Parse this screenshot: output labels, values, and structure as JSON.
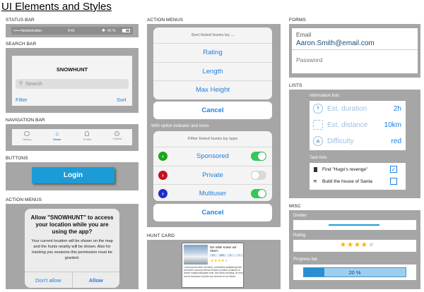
{
  "page": {
    "title": "UI Elements and Styles"
  },
  "labels": {
    "status_bar": "STATUS BAR",
    "search_bar": "SEARCH BAR",
    "navigation_bar": "NAVIGATION BAR",
    "buttons": "BUTTONS",
    "action_menus_left": "ACTION MENUS",
    "action_menus_mid": "ACTION MENUS",
    "hunt_card": "HUNT CARD",
    "forms": "FORMS",
    "lists": "LISTS",
    "misc": "MISC"
  },
  "status_bar": {
    "carrier": "••••• Netzbetreiber",
    "time": "9:41",
    "battery": "42 %"
  },
  "search_bar": {
    "title": "SNOWHUNT",
    "placeholder": "Search",
    "filter": "Filter",
    "sort": "Sort"
  },
  "nav_bar": {
    "tabs": [
      {
        "label": "History",
        "icon": "history-icon"
      },
      {
        "label": "Home",
        "icon": "home-icon"
      },
      {
        "label": "Profile",
        "icon": "profile-icon"
      },
      {
        "label": "Tutorial",
        "icon": "tutorial-icon"
      }
    ],
    "active_tab": "Home"
  },
  "buttons": {
    "login": "Login"
  },
  "alert": {
    "title": "Allow \"SNOWHUNT\" to access your location while you are using the app?",
    "message": "Your current location will be shown on the map and the hunts nearby will be shown. Also for tracking you sessions this permission must be granted.",
    "dont_allow": "Don't allow",
    "allow": "Allow"
  },
  "sort_sheet": {
    "header": "Sort listed hunts by ...",
    "options": [
      "Rating",
      "Length",
      "Max Height"
    ],
    "cancel": "Cancel"
  },
  "filter_sheet": {
    "caption": "With option indicator and icons",
    "header": "Filter listed hunts by type",
    "options": [
      {
        "label": "Sponsored",
        "color": "#1aa51e",
        "on": true
      },
      {
        "label": "Private",
        "color": "#c8101e",
        "on": false
      },
      {
        "label": "Multiuser",
        "color": "#1f2fc9",
        "on": true
      }
    ],
    "cancel": "Cancel"
  },
  "hunt_card": {
    "title": "Der wilde Kaiser auf Skiern",
    "stats": [
      "10",
      "360",
      "5",
      "7"
    ],
    "rating": 4,
    "text": "Lorem ipsum dolor sit amet, consetetur sadipscing elitr, sed diam nonumy eirmod tempor invidunt ut labore et dolore magna aliquyam erat, sed diam voluptua. At vero eos et accusam et justo duo dolores et ea rebum."
  },
  "forms": {
    "email_label": "Email",
    "email_value": "Aaron.Smith@email.com",
    "password_placeholder": "Password"
  },
  "lists": {
    "info_title": "Information lists",
    "info_items": [
      {
        "label": "Est. duration",
        "value": "2h",
        "icon": "clock-icon"
      },
      {
        "label": "Est. distance",
        "value": "10km",
        "icon": "distance-icon"
      },
      {
        "label": "Difficulty",
        "value": "red",
        "icon": "difficulty-icon"
      }
    ],
    "task_title": "Task lists",
    "task_items": [
      {
        "label": "Find \"Hugo's revenge\"",
        "done": true,
        "icon": "bookmark-icon"
      },
      {
        "label": "Build the house of Santa",
        "done": false,
        "icon": "layers-icon"
      }
    ]
  },
  "misc": {
    "divider_label": "Divider",
    "rating_label": "Rating",
    "rating_value": 4,
    "rating_max": 5,
    "progress_label": "Progress bar",
    "progress_text": "20 %",
    "progress_value": 0.2
  },
  "colors": {
    "panel": "#a6a6a6",
    "accent": "#1e7fe0",
    "login": "#1d9bd6",
    "star": "#f4b400"
  }
}
